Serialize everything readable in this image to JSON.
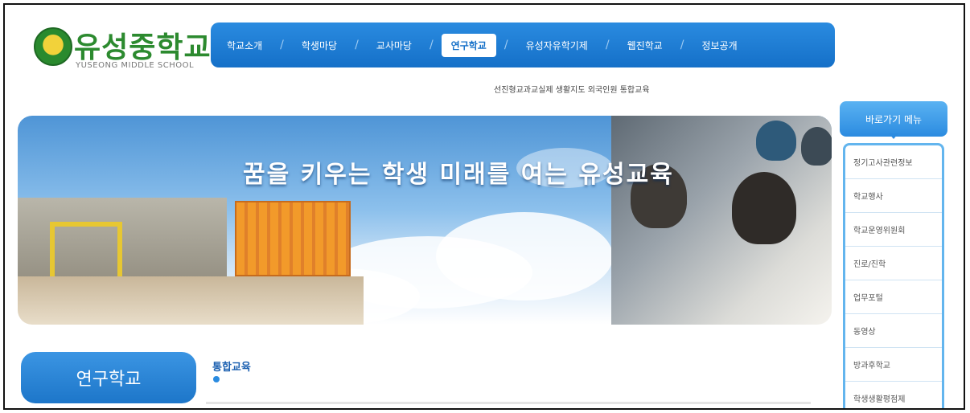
{
  "school": {
    "name": "유성중학교",
    "name_en": "YUSEONG MIDDLE SCHOOL"
  },
  "nav": {
    "items": [
      {
        "label": "학교소개"
      },
      {
        "label": "학생마당"
      },
      {
        "label": "교사마당"
      },
      {
        "label": "연구학교",
        "active": true
      },
      {
        "label": "유성자유학기제"
      },
      {
        "label": "웹진학교"
      },
      {
        "label": "정보공개"
      }
    ],
    "sub_items": "선진형교과교실제 생활지도 외국인원 통합교육"
  },
  "banner": {
    "slogan": "꿈을 키우는 학생 미래를 여는 유성교육"
  },
  "section": {
    "title": "연구학교",
    "subtitle": "",
    "content_heading": "통합교육"
  },
  "quick_menu": {
    "title": "바로가기 메뉴",
    "items": [
      "정기고사관련정보",
      "학교행사",
      "학교운영위원회",
      "진로/진학",
      "업무포털",
      "동영상",
      "방과후학교",
      "학생생활평점제"
    ]
  },
  "colors": {
    "nav_blue": "#1570c8",
    "logo_green": "#2c8a2f",
    "quick_border": "#63b5ee"
  }
}
